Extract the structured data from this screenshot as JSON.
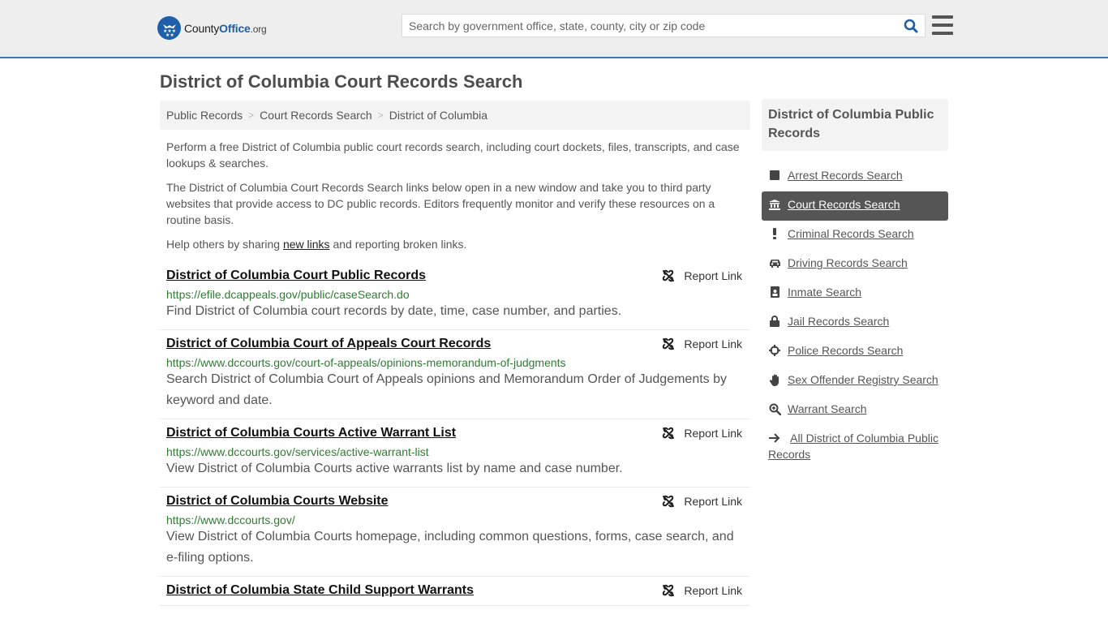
{
  "header": {
    "logo": {
      "part1": "County",
      "part2": "Office",
      "part3": ".org"
    },
    "search_placeholder": "Search by government office, state, county, city or zip code",
    "search_value": ""
  },
  "page": {
    "title": "District of Columbia Court Records Search"
  },
  "breadcrumb": [
    {
      "label": "Public Records"
    },
    {
      "label": "Court Records Search"
    },
    {
      "label": "District of Columbia"
    }
  ],
  "intro": {
    "p1": "Perform a free District of Columbia public court records search, including court dockets, files, transcripts, and case lookups & searches.",
    "p2": "The District of Columbia Court Records Search links below open in a new window and take you to third party websites that provide access to DC public records. Editors frequently monitor and verify these resources on a routine basis.",
    "p3_before": "Help others by sharing ",
    "p3_link": "new links",
    "p3_after": " and reporting broken links."
  },
  "report_label": "Report Link",
  "results": [
    {
      "title": "District of Columbia Court Public Records",
      "url": "https://efile.dcappeals.gov/public/caseSearch.do",
      "desc": "Find District of Columbia court records by date, time, case number, and parties."
    },
    {
      "title": "District of Columbia Court of Appeals Court Records",
      "url": "https://www.dccourts.gov/court-of-appeals/opinions-memorandum-of-judgments",
      "desc": "Search District of Columbia Court of Appeals opinions and Memorandum Order of Judgements by keyword and date."
    },
    {
      "title": "District of Columbia Courts Active Warrant List",
      "url": "https://www.dccourts.gov/services/active-warrant-list",
      "desc": "View District of Columbia Courts active warrants list by name and case number."
    },
    {
      "title": "District of Columbia Courts Website",
      "url": "https://www.dccourts.gov/",
      "desc": "View District of Columbia Courts homepage, including common questions, forms, case search, and e-filing options."
    },
    {
      "title": "District of Columbia State Child Support Warrants",
      "url": "",
      "desc": ""
    }
  ],
  "sidebar": {
    "heading": "District of Columbia Public Records",
    "items": [
      {
        "label": "Arrest Records Search",
        "icon": "square-icon",
        "active": false
      },
      {
        "label": "Court Records Search",
        "icon": "courthouse-icon",
        "active": true
      },
      {
        "label": "Criminal Records Search",
        "icon": "exclamation-icon",
        "active": false
      },
      {
        "label": "Driving Records Search",
        "icon": "car-icon",
        "active": false
      },
      {
        "label": "Inmate Search",
        "icon": "id-badge-icon",
        "active": false
      },
      {
        "label": "Jail Records Search",
        "icon": "lock-icon",
        "active": false
      },
      {
        "label": "Police Records Search",
        "icon": "crosshairs-icon",
        "active": false
      },
      {
        "label": "Sex Offender Registry Search",
        "icon": "hand-icon",
        "active": false
      },
      {
        "label": "Warrant Search",
        "icon": "search-plus-icon",
        "active": false
      },
      {
        "label": "All District of Columbia Public Records",
        "icon": "arrow-right-icon",
        "active": false
      }
    ]
  },
  "colors": {
    "brand_blue": "#1f5ea8",
    "header_border": "#3a7ab3",
    "url_green": "#2e7d32",
    "active_bg": "#555555"
  }
}
